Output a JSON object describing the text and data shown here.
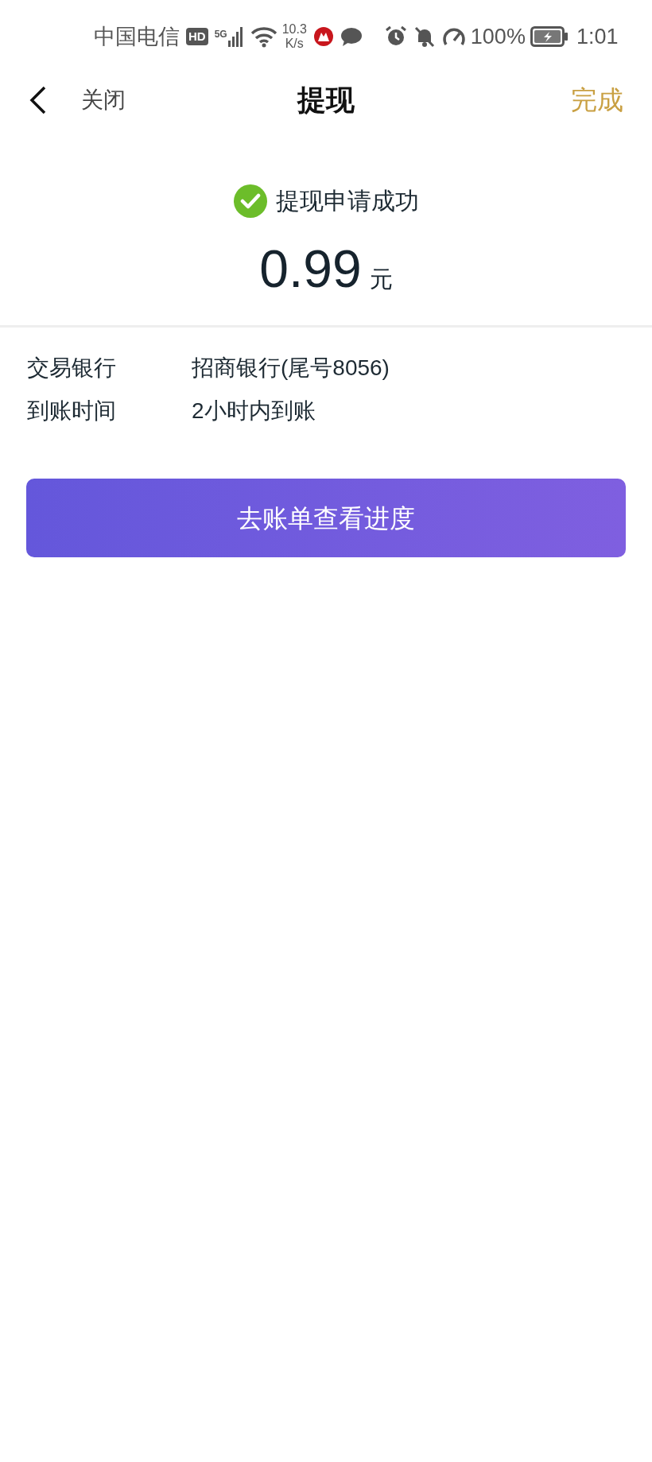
{
  "status_bar": {
    "carrier": "中国电信",
    "hd_badge": "HD",
    "network_type": "5G",
    "speed_value": "10.3",
    "speed_unit": "K/s",
    "battery": "100%",
    "time": "1:01"
  },
  "nav": {
    "close": "关闭",
    "title": "提现",
    "done": "完成"
  },
  "result": {
    "message": "提现申请成功",
    "amount": "0.99",
    "unit": "元"
  },
  "details": [
    {
      "label": "交易银行",
      "value": "招商银行(尾号8056)"
    },
    {
      "label": "到账时间",
      "value": "2小时内到账"
    }
  ],
  "action_button": "去账单查看进度"
}
